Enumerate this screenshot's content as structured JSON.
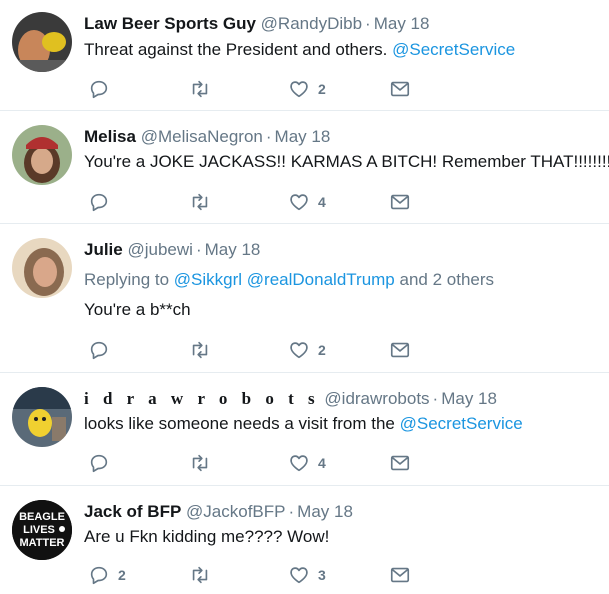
{
  "tweets": [
    {
      "name": "Law Beer Sports Guy",
      "handle": "@RandyDibb",
      "time": "May 18",
      "text_prefix": "Threat against the President and others.",
      "text_mention": "@SecretService",
      "reply_count": "",
      "retweet_count": "",
      "like_count": "2"
    },
    {
      "name": "Melisa",
      "handle": "@MelisaNegron",
      "time": "May 18",
      "text": "You're a JOKE JACKASS!! KARMAS A BITCH! Remember THAT!!!!!!!!!",
      "reply_count": "",
      "retweet_count": "",
      "like_count": "4"
    },
    {
      "name": "Julie",
      "handle": "@jubewi",
      "time": "May 18",
      "replying_prefix": "Replying to",
      "replying_mention1": "@Sikkgrl",
      "replying_mention2": "@realDonaldTrump",
      "replying_suffix": "and 2 others",
      "text": "You're a b**ch",
      "reply_count": "",
      "retweet_count": "",
      "like_count": "2"
    },
    {
      "name": "i d r a w r o b o t s",
      "handle": "@idrawrobots",
      "time": "May 18",
      "text_prefix": "looks like someone needs a visit from the",
      "text_mention": "@SecretService",
      "reply_count": "",
      "retweet_count": "",
      "like_count": "4"
    },
    {
      "name": "Jack of BFP",
      "handle": "@JackofBFP",
      "time": "May 18",
      "text": "Are u Fkn kidding me???? Wow!",
      "avatar_text": [
        "BEAGLE",
        "LIVES",
        "MATTER"
      ],
      "reply_count": "2",
      "retweet_count": "",
      "like_count": "3"
    }
  ],
  "separator": "·",
  "colors": {
    "link": "#1b95e0",
    "muted": "#657786",
    "text": "#14171a",
    "border": "#e6ecf0"
  }
}
